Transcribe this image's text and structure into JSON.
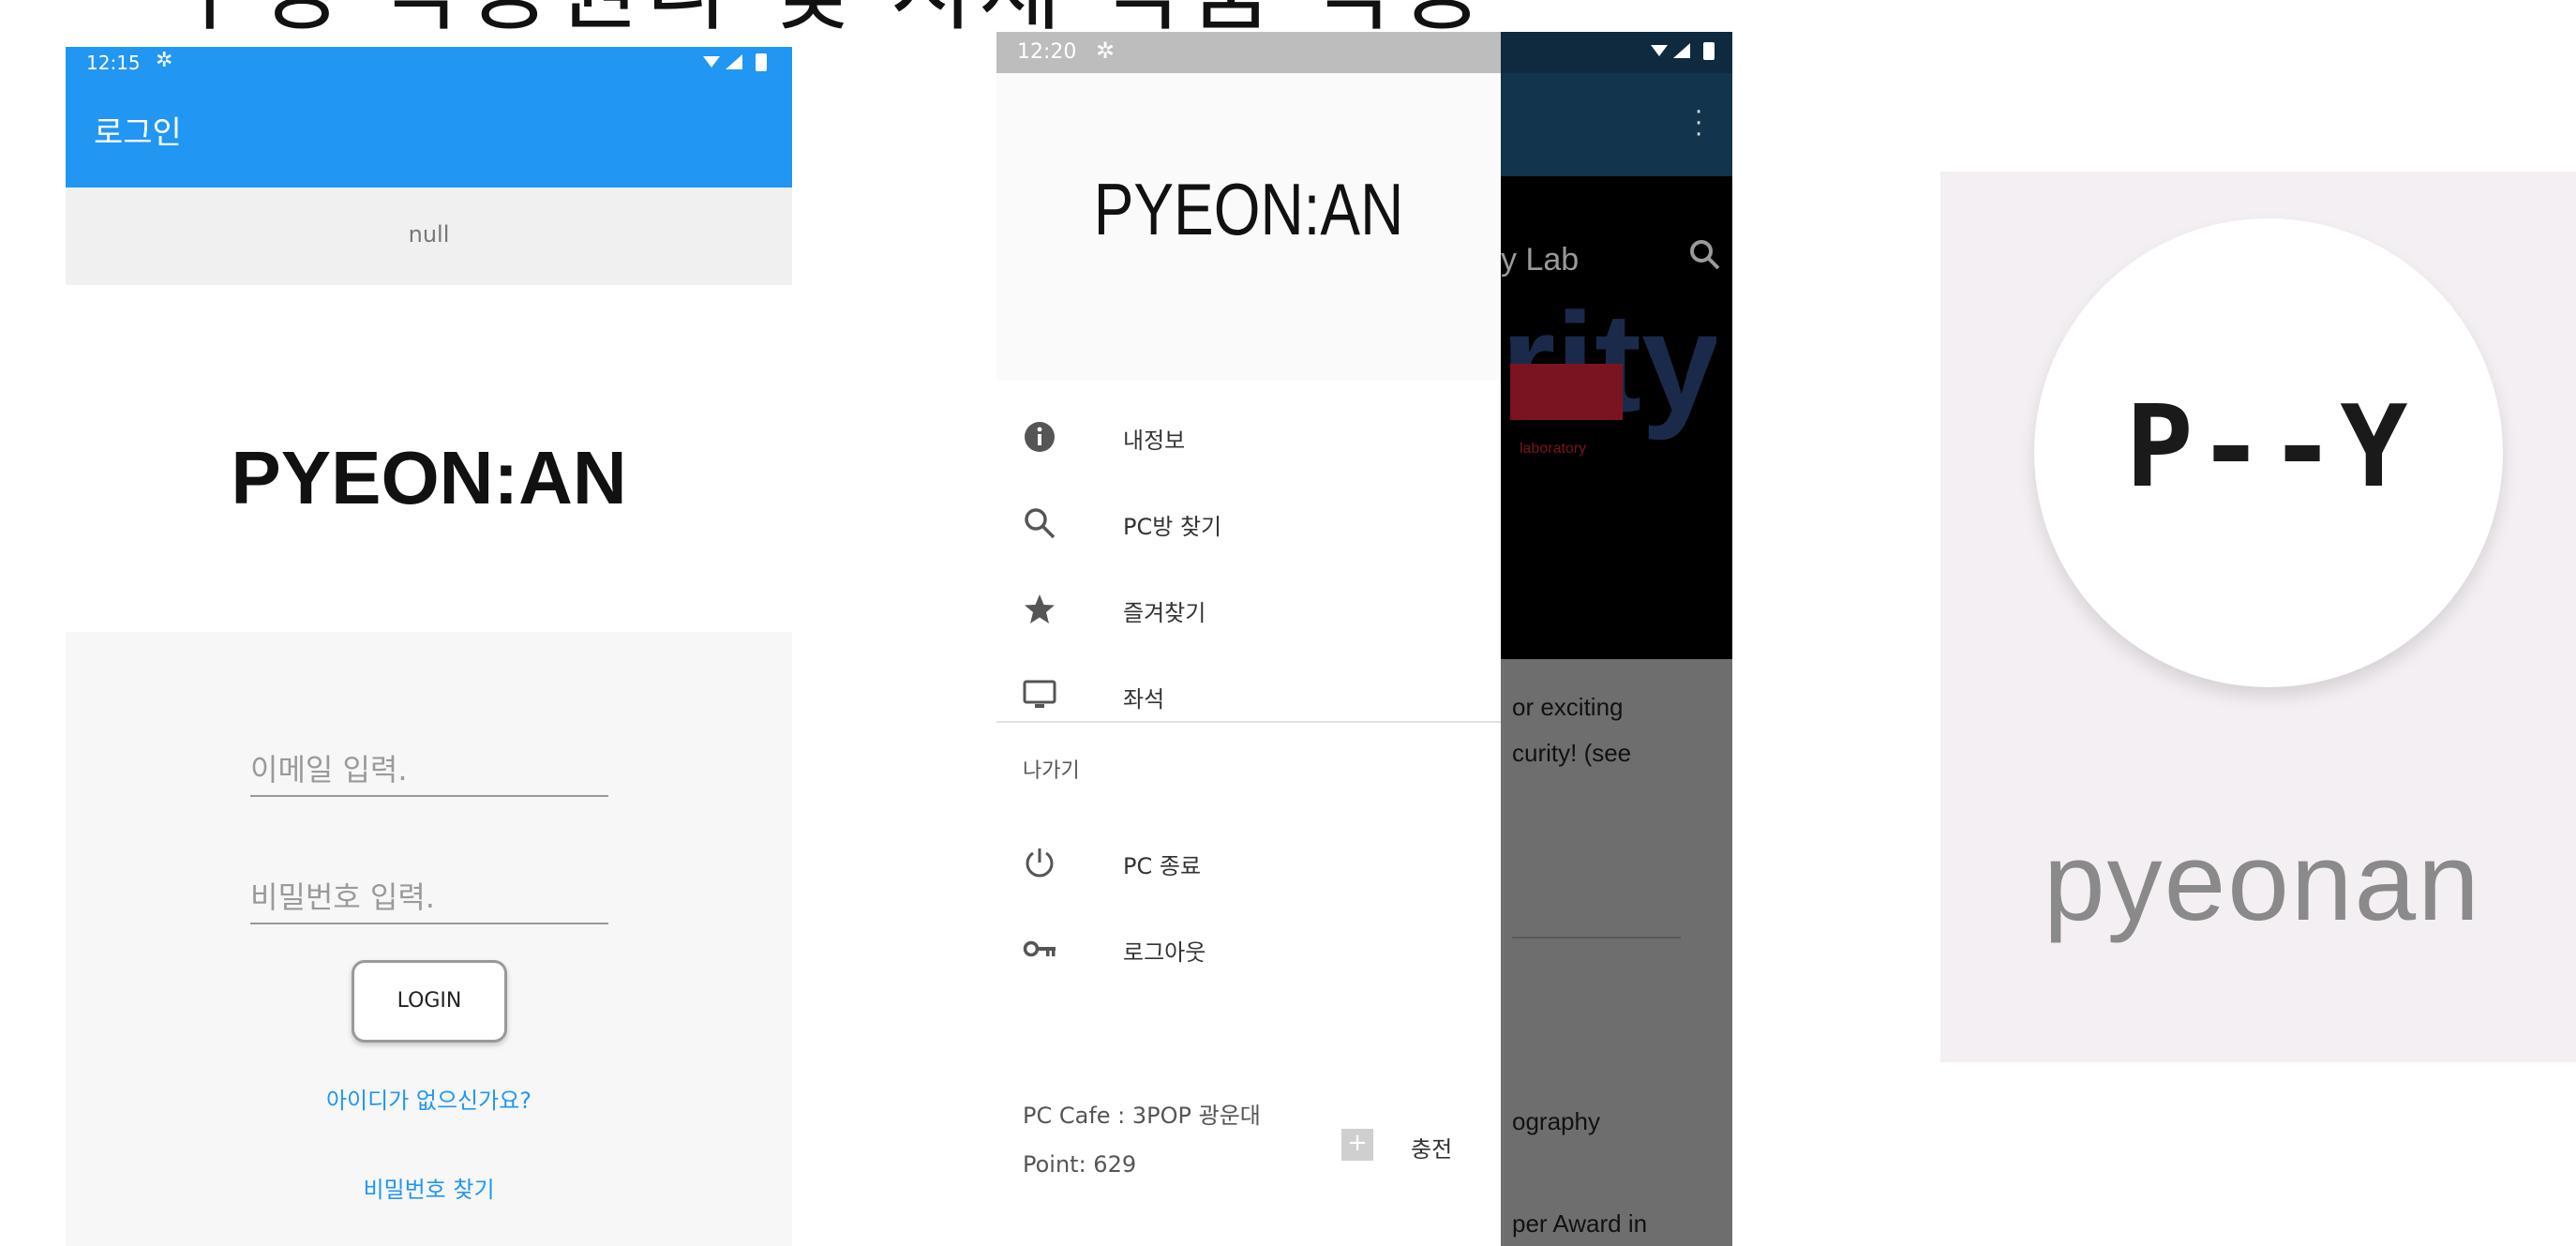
{
  "headline": "구성  작동원리  및  시제  작품  작동",
  "login_screen": {
    "status_time": "12:15",
    "title": "로그인",
    "null_text": "null",
    "brand": "PYEON:AN",
    "email_placeholder": "이메일 입력.",
    "password_placeholder": "비밀번호 입력.",
    "login_button": "LOGIN",
    "signup_link": "아이디가 없으신가요?",
    "find_password_link": "비밀번호 찾기",
    "accent_color": "#2196f3"
  },
  "drawer_screen": {
    "status_time": "12:20",
    "brand": "PYEON:AN",
    "menu": [
      {
        "label": "내정보",
        "icon": "info-icon"
      },
      {
        "label": "PC방 찾기",
        "icon": "search-icon"
      },
      {
        "label": "즐겨찾기",
        "icon": "star-icon"
      },
      {
        "label": "좌석",
        "icon": "monitor-icon"
      }
    ],
    "section_label": "나가기",
    "exit_menu": [
      {
        "label": "PC 종료",
        "icon": "power-icon"
      },
      {
        "label": "로그아웃",
        "icon": "key-icon"
      }
    ],
    "pc_cafe": "PC Cafe :  3POP  광운대",
    "point": "Point:  629",
    "charge_label": "충전",
    "background": {
      "toolbar_fragment": "y Lab",
      "text_fragments": [
        "or exciting",
        "curity! (see",
        "ography",
        "per Award in"
      ]
    }
  },
  "app_icon": {
    "mark": "P--Y",
    "name": "pyeonan"
  }
}
